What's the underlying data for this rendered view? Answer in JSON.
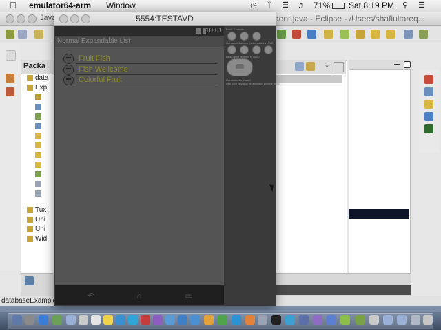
{
  "menubar": {
    "app_name": "emulator64-arm",
    "menu_window": "Window",
    "battery": "71%",
    "datetime": "Sat 8:19 PM"
  },
  "eclipse": {
    "title": "dent.java - Eclipse - /Users/shafiultareq...",
    "tab_java": "Java",
    "package_tab": "Packa",
    "tree": [
      "data",
      "Exp",
      "",
      "",
      "",
      "",
      "",
      "",
      "",
      "",
      "",
      "",
      "",
      "Tux",
      "Uni",
      "Uni",
      "Wid"
    ],
    "status_text": "databaseExample"
  },
  "emulator": {
    "window_title": "5554:TESTAVD",
    "clock": "10:01",
    "app_title": "Normal Expandable List",
    "groups": [
      "Fruit Fish",
      "Fish Wellcome",
      "Colorful Fruit"
    ]
  },
  "controls": {
    "section_basic": "Basic Controls",
    "section_hardware": "Hardware Buttons (not enabled in AVD)",
    "section_dpad": "DPAD (not enabled in AVD)",
    "section_keyboard": "Hardware Keyboard",
    "keyboard_hint": "Use your physical keyboard to provide input"
  },
  "colors": {
    "list_text": "#8b8a2d",
    "screen_bg": "#545454",
    "controls_bg": "#3a3a3a"
  }
}
